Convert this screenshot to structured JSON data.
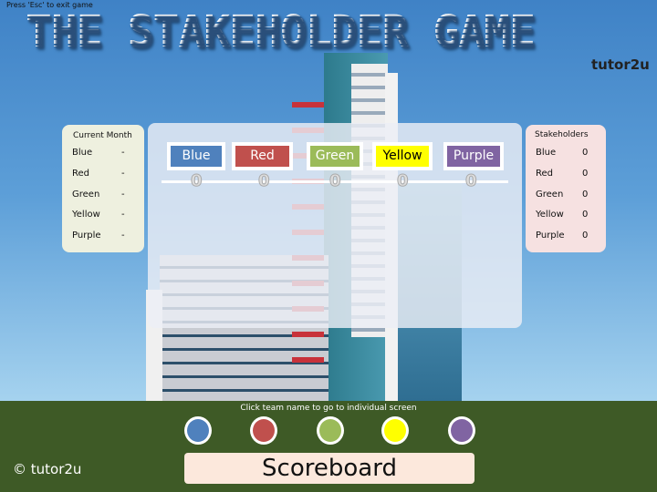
{
  "header": {
    "esc_hint": "Press 'Esc' to exit game",
    "title": "THE STAKEHOLDER GAME",
    "logo": "tutor2u"
  },
  "current_month": {
    "title": "Current Month",
    "rows": [
      {
        "team": "Blue",
        "value": "-"
      },
      {
        "team": "Red",
        "value": "-"
      },
      {
        "team": "Green",
        "value": "-"
      },
      {
        "team": "Yellow",
        "value": "-"
      },
      {
        "team": "Purple",
        "value": "-"
      }
    ]
  },
  "stakeholders": {
    "title": "Stakeholders",
    "rows": [
      {
        "team": "Blue",
        "value": "0"
      },
      {
        "team": "Red",
        "value": "0"
      },
      {
        "team": "Green",
        "value": "0"
      },
      {
        "team": "Yellow",
        "value": "0"
      },
      {
        "team": "Purple",
        "value": "0"
      }
    ]
  },
  "teams": [
    {
      "label": "Blue",
      "score": "0",
      "color": "#4f81bd",
      "text": "#ffffff"
    },
    {
      "label": "Red",
      "score": "0",
      "color": "#c0504d",
      "text": "#ffffff"
    },
    {
      "label": "Green",
      "score": "0",
      "color": "#9bbb59",
      "text": "#ffffff"
    },
    {
      "label": "Yellow",
      "score": "0",
      "color": "#ffff00",
      "text": "#000000"
    },
    {
      "label": "Purple",
      "score": "0",
      "color": "#8064a2",
      "text": "#ffffff"
    }
  ],
  "footer": {
    "hint": "Click team name to go to individual screen",
    "scoreboard": "Scoreboard",
    "copyright": "© tutor2u"
  }
}
